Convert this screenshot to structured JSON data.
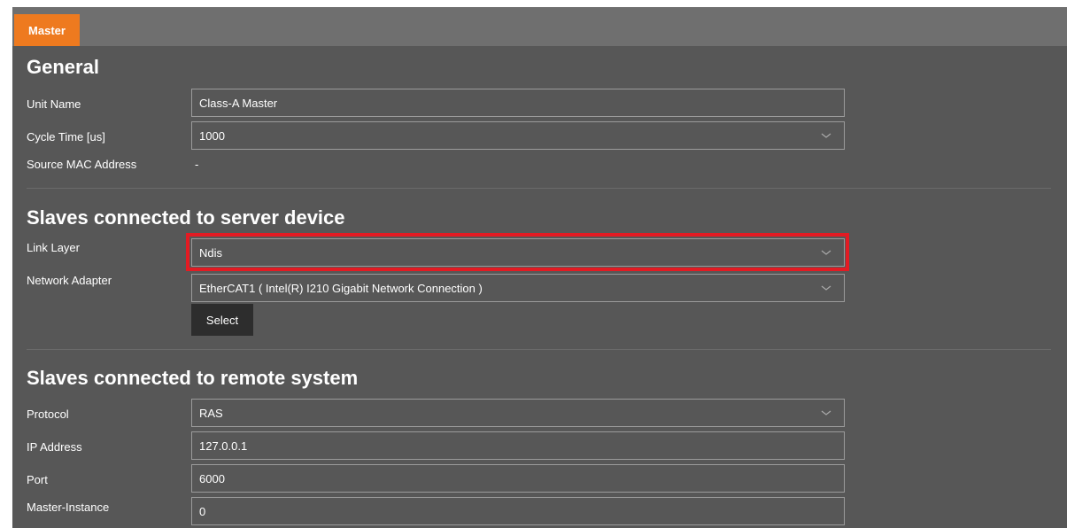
{
  "tab": {
    "label": "Master"
  },
  "general": {
    "title": "General",
    "unit_name": {
      "label": "Unit Name",
      "value": "Class-A Master"
    },
    "cycle_time": {
      "label": "Cycle Time [us]",
      "value": "1000"
    },
    "source_mac": {
      "label": "Source MAC Address",
      "value": "-"
    }
  },
  "server_device": {
    "title": "Slaves connected to server device",
    "link_layer": {
      "label": "Link Layer",
      "value": "Ndis"
    },
    "network_adapter": {
      "label": "Network Adapter",
      "value": "EtherCAT1 ( Intel(R) I210 Gigabit Network Connection )"
    },
    "select_label": "Select"
  },
  "remote_system": {
    "title": "Slaves connected to remote system",
    "protocol": {
      "label": "Protocol",
      "value": "RAS"
    },
    "ip_address": {
      "label": "IP Address",
      "value": "127.0.0.1"
    },
    "port": {
      "label": "Port",
      "value": "6000"
    },
    "master_instance": {
      "label": "Master-Instance",
      "value": "0"
    }
  },
  "colors": {
    "tab_accent": "#ee7a1f",
    "highlight": "#e31b23",
    "panel_bg": "#575757"
  },
  "icons": {
    "dropdown": "chevron-down-icon"
  }
}
